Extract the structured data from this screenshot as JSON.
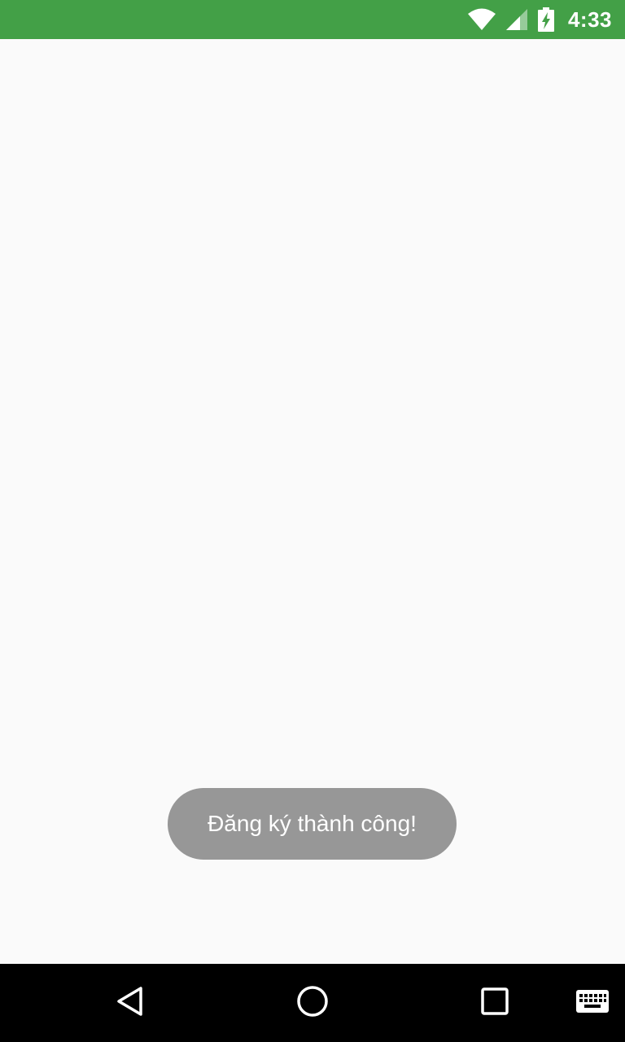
{
  "status_bar": {
    "time": "4:33",
    "background": "#43a047",
    "icons": [
      "wifi-icon",
      "cell-signal-icon",
      "battery-charging-icon"
    ]
  },
  "toast": {
    "message": "Đăng ký thành công!",
    "background": "#979797"
  },
  "nav_bar": {
    "buttons": [
      "back-icon",
      "home-icon",
      "recents-icon",
      "keyboard-icon"
    ]
  }
}
